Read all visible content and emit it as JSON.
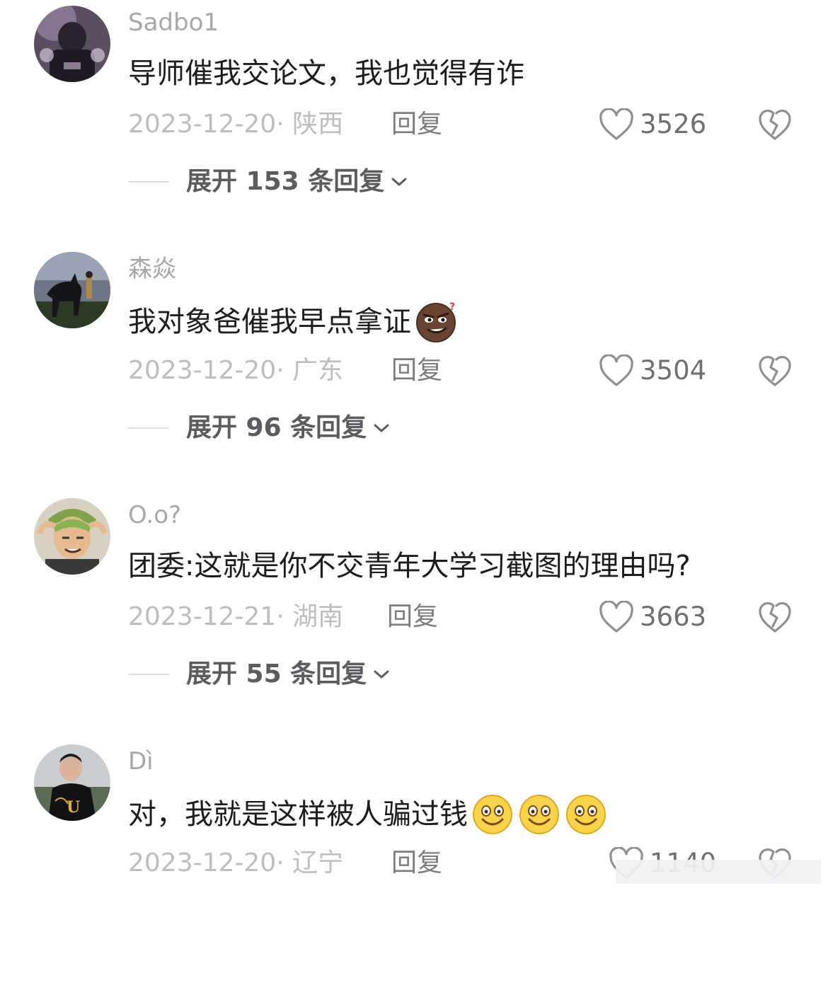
{
  "comments": [
    {
      "username": "Sadbo1",
      "text": "导师催我交论文，我也觉得有诈",
      "emojis": [],
      "date": "2023-12-20",
      "location": "陕西",
      "reply_label": "回复",
      "likes": "3526",
      "expand_label": "展开 153 条回复"
    },
    {
      "username": "森焱",
      "text": "我对象爸催我早点拿证",
      "emojis": [
        "smirk-emoji"
      ],
      "date": "2023-12-20",
      "location": "广东",
      "reply_label": "回复",
      "likes": "3504",
      "expand_label": "展开 96 条回复"
    },
    {
      "username": "O.o?",
      "text": "团委:这就是你不交青年大学习截图的理由吗?",
      "emojis": [],
      "date": "2023-12-21",
      "location": "湖南",
      "reply_label": "回复",
      "likes": "3663",
      "expand_label": "展开 55 条回复"
    },
    {
      "username": "Dì",
      "text": "对，我就是这样被人骗过钱",
      "emojis": [
        "smile-emoji",
        "smile-emoji",
        "smile-emoji"
      ],
      "date": "2023-12-20",
      "location": "辽宁",
      "reply_label": "回复",
      "likes": "1140",
      "expand_label": ""
    }
  ],
  "meta_separator": "·",
  "colors": {
    "username": "#a7a7ab",
    "text": "#1c1c1e",
    "meta": "#bdbdc1",
    "reply": "#7c7c80",
    "likes": "#6e6e73",
    "expand": "#5c5c60"
  }
}
